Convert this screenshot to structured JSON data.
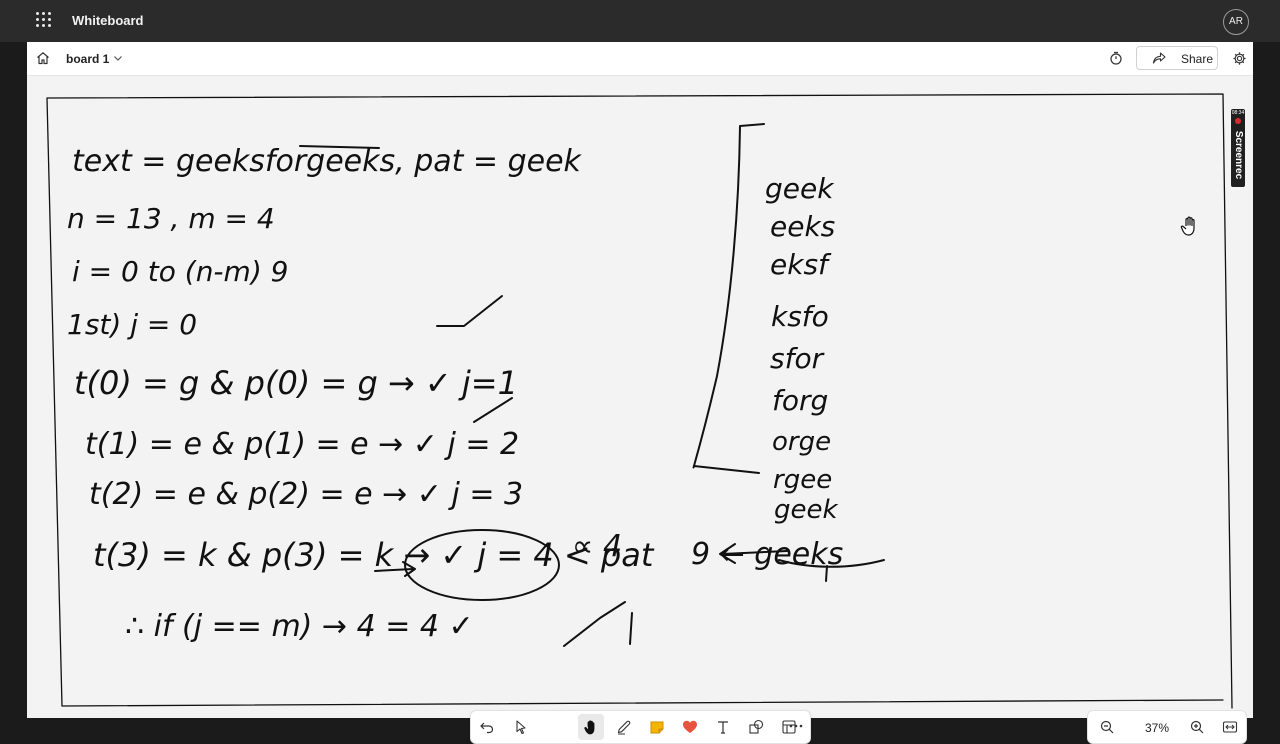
{
  "app": {
    "title": "Whiteboard",
    "user_initials": "AR"
  },
  "toolbar": {
    "board_name": "board 1",
    "share_label": "Share"
  },
  "screenrec": {
    "time": "08:34",
    "brand": "Screenrec"
  },
  "dock": {
    "tools": [
      "undo-icon",
      "select-icon",
      "hand-icon",
      "pen-icon",
      "sticky-note-icon",
      "reaction-icon",
      "text-icon",
      "shapes-icon",
      "template-icon",
      "more-icon"
    ],
    "active_tool": "hand-icon"
  },
  "zoom": {
    "level": "37%"
  },
  "board_notes": {
    "line1": "text = geeksforgeeks, pat = geek",
    "step1": "n = 13 , m = 4",
    "step2": "i = 0 to (n-m) 9",
    "first": "1st) j = 0",
    "t0": "t(0) = g & p(0) = g → ✓ j=1",
    "t1": "t(1) = e & p(1) = e → ✓ j = 2",
    "t2": "t(2) = e & p(2) = e → ✓ j = 3",
    "t3": "t(3) = k & p(3) = k → ✓ j = 4 < pat",
    "t3_note": "∝ 4",
    "conclusion": "∴ if (j == m) → 4 = 4 ✓",
    "windows": [
      "geek",
      "eeks",
      "eksf",
      "ksfo",
      "sfor",
      "forg",
      "orge",
      "rgee",
      "geek"
    ],
    "arrow_note": "9 ← geeks"
  },
  "colors": {
    "title_bar": "#2b2b2b",
    "canvas": "#f3f3f3",
    "ink": "#111111",
    "record_dot": "#d92b2b"
  }
}
